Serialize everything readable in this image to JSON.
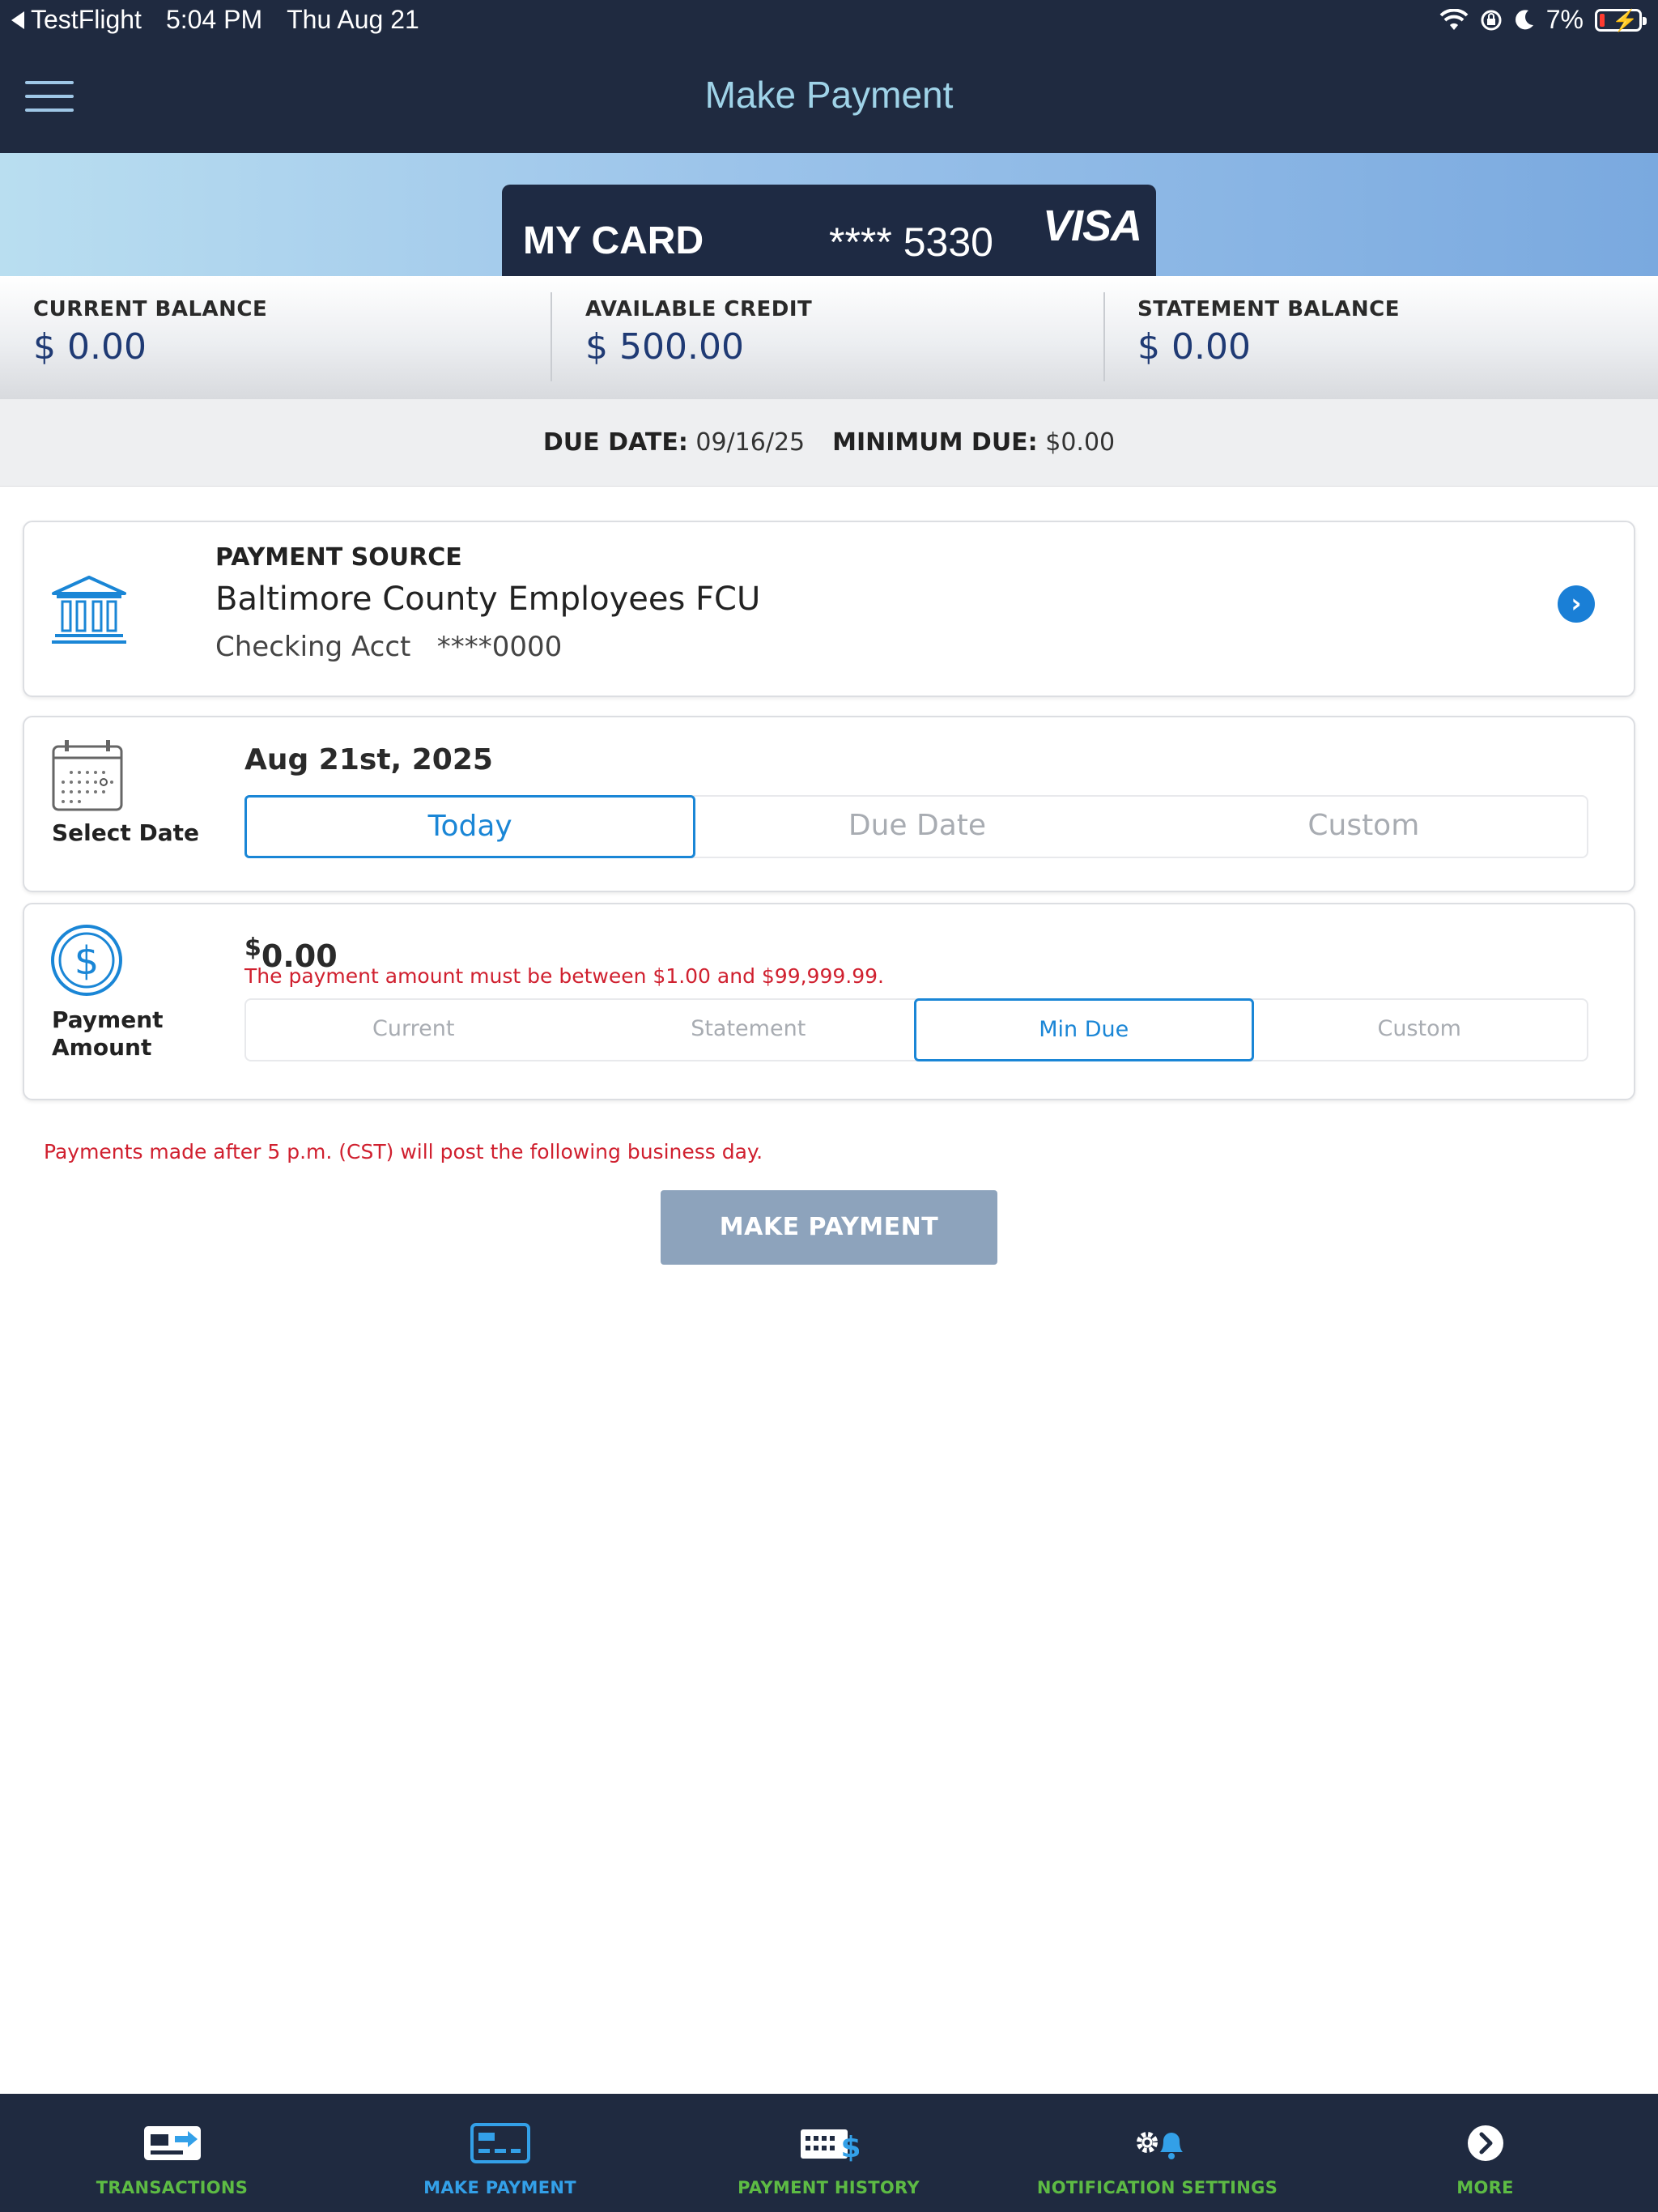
{
  "status_bar": {
    "back_app": "TestFlight",
    "time": "5:04 PM",
    "date": "Thu Aug 21",
    "battery": "7%"
  },
  "header": {
    "title": "Make Payment"
  },
  "card": {
    "name": "MY CARD",
    "number_masked": "**** 5330",
    "brand": "VISA"
  },
  "balances": {
    "current": {
      "label": "CURRENT BALANCE",
      "value": "$ 0.00"
    },
    "available": {
      "label": "AVAILABLE CREDIT",
      "value": "$ 500.00"
    },
    "statement": {
      "label": "STATEMENT BALANCE",
      "value": "$ 0.00"
    }
  },
  "due": {
    "due_date_label": "DUE DATE:",
    "due_date_value": "09/16/25",
    "min_due_label": "MINIMUM DUE:",
    "min_due_value": "$0.00"
  },
  "payment_source": {
    "label": "PAYMENT SOURCE",
    "institution": "Baltimore County Employees FCU",
    "account": "Checking Acct   ****0000"
  },
  "select_date": {
    "caption": "Select Date",
    "selected": "Aug 21st, 2025",
    "options": [
      "Today",
      "Due Date",
      "Custom"
    ],
    "active_option": "Today"
  },
  "payment_amount": {
    "caption": "Payment Amount",
    "currency_symbol": "$",
    "amount": "0.00",
    "error": "The payment amount must be between $1.00 and $99,999.99.",
    "options": [
      "Current",
      "Statement",
      "Min Due",
      "Custom"
    ],
    "active_option": "Min Due"
  },
  "notice": "Payments made after 5 p.m. (CST) will post the following business day.",
  "make_payment_button": "MAKE PAYMENT",
  "tabbar": {
    "items": [
      {
        "label": "TRANSACTIONS",
        "icon": "transactions-icon"
      },
      {
        "label": "MAKE PAYMENT",
        "icon": "card-payment-icon"
      },
      {
        "label": "PAYMENT HISTORY",
        "icon": "payment-history-icon"
      },
      {
        "label": "NOTIFICATION SETTINGS",
        "icon": "notification-settings-icon"
      },
      {
        "label": "MORE",
        "icon": "more-chevron-icon"
      }
    ],
    "active": "MAKE PAYMENT"
  },
  "colors": {
    "navy": "#1f2a40",
    "accent_blue": "#1a86d6",
    "balance_text": "#1f3a74",
    "error_red": "#d0202f",
    "tab_green": "#5dbb44",
    "tab_active": "#33a0e8",
    "button_disabled": "#8da3bc"
  }
}
